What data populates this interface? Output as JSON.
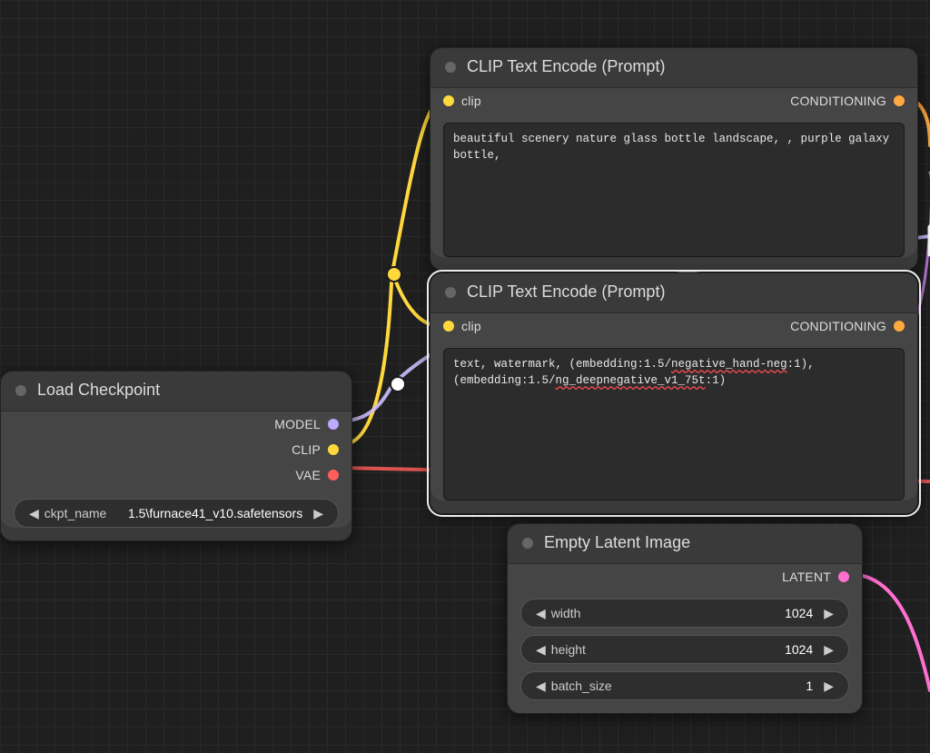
{
  "colors": {
    "model": "#bda9ff",
    "clip": "#ffd83d",
    "vae": "#ff5c5c",
    "conditioning": "#ffa940",
    "latent": "#ff6fcf"
  },
  "nodes": {
    "load_checkpoint": {
      "title": "Load Checkpoint",
      "outputs": {
        "model": "MODEL",
        "clip": "CLIP",
        "vae": "VAE"
      },
      "widget": {
        "name": "ckpt_name",
        "value": "1.5\\furnace41_v10.safetensors"
      }
    },
    "clip_prompt_pos": {
      "title": "CLIP Text Encode (Prompt)",
      "inputs": {
        "clip": "clip"
      },
      "outputs": {
        "conditioning": "CONDITIONING"
      },
      "text": "beautiful scenery nature glass bottle landscape, , purple galaxy bottle,"
    },
    "clip_prompt_neg": {
      "title": "CLIP Text Encode (Prompt)",
      "inputs": {
        "clip": "clip"
      },
      "outputs": {
        "conditioning": "CONDITIONING"
      },
      "text_prefix": "text, watermark, (embedding:1.5/",
      "text_red": "negative_hand-neg",
      "text_mid": ":1),\n(embedding:1.5/",
      "text_red2": "ng_deepnegative_v1_75t",
      "text_suffix": ":1)"
    },
    "empty_latent": {
      "title": "Empty Latent Image",
      "outputs": {
        "latent": "LATENT"
      },
      "widgets": [
        {
          "name": "width",
          "value": "1024"
        },
        {
          "name": "height",
          "value": "1024"
        },
        {
          "name": "batch_size",
          "value": "1"
        }
      ]
    }
  }
}
